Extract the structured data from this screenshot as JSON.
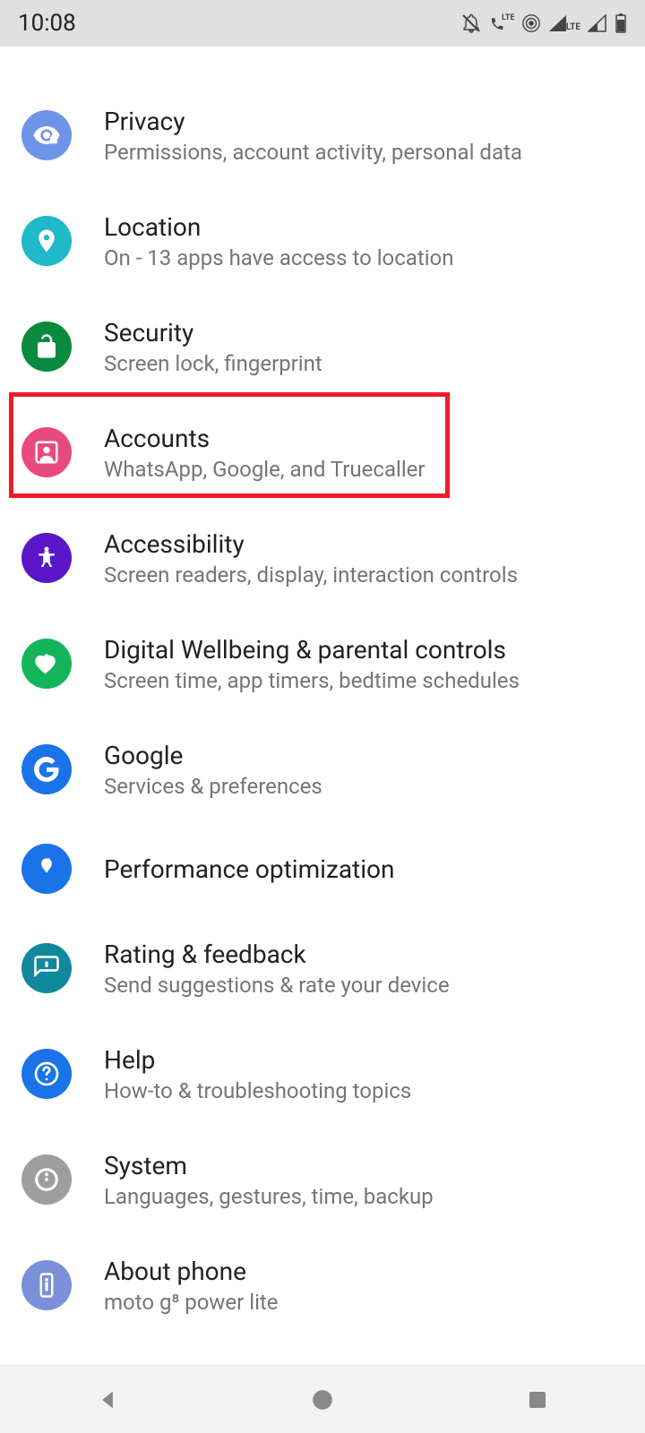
{
  "status": {
    "time": "10:08",
    "lte": "LTE"
  },
  "items": [
    {
      "title": "Privacy",
      "subtitle": "Permissions, account activity, personal data",
      "color": "#6d94e8"
    },
    {
      "title": "Location",
      "subtitle": "On - 13 apps have access to location",
      "color": "#1fb9c9"
    },
    {
      "title": "Security",
      "subtitle": "Screen lock, fingerprint",
      "color": "#0a8a3f"
    },
    {
      "title": "Accounts",
      "subtitle": "WhatsApp, Google, and Truecaller",
      "color": "#e84a80"
    },
    {
      "title": "Accessibility",
      "subtitle": "Screen readers, display, interaction controls",
      "color": "#5b16c9"
    },
    {
      "title": "Digital Wellbeing & parental controls",
      "subtitle": "Screen time, app timers, bedtime schedules",
      "color": "#14b55a"
    },
    {
      "title": "Google",
      "subtitle": "Services & preferences",
      "color": "#1a73e8"
    },
    {
      "title": "Performance optimization",
      "subtitle": "",
      "color": "#1a73e8"
    },
    {
      "title": "Rating & feedback",
      "subtitle": "Send suggestions & rate your device",
      "color": "#0e8a9c"
    },
    {
      "title": "Help",
      "subtitle": "How-to & troubleshooting topics",
      "color": "#1a73e8"
    },
    {
      "title": "System",
      "subtitle": "Languages, gestures, time, backup",
      "color": "#9e9e9e"
    },
    {
      "title": "About phone",
      "subtitle": "moto g⁸ power lite",
      "color": "#7b90d8"
    }
  ]
}
